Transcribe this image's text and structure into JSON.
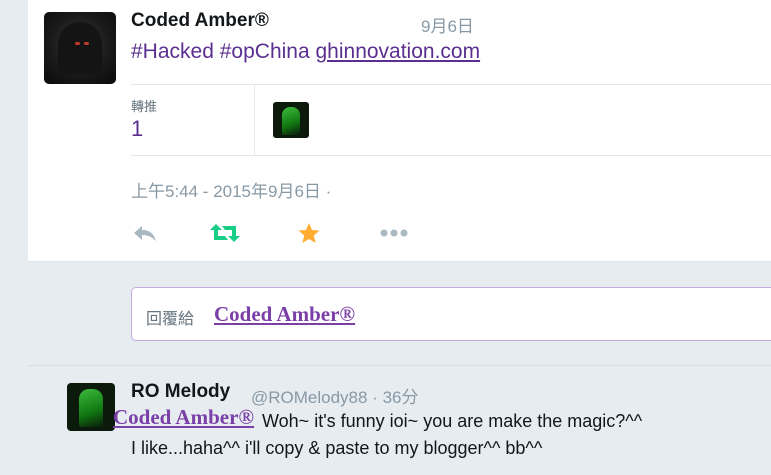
{
  "colors": {
    "link": "#5b2f8f",
    "mention": "#7b3fa8",
    "muted": "#8899a6",
    "retweet_green": "#19cf86",
    "favorite_gold": "#ffac33",
    "icon_gray": "#aab8c2"
  },
  "tweet": {
    "author_name": "Coded Amber®",
    "date_short": "9月6日",
    "hashtag1": "#Hacked",
    "hashtag2": "#opChina",
    "link": "ghinnovation.com",
    "retweet_label": "轉推",
    "retweet_count": "1",
    "timestamp": "上午5:44 - 2015年9月6日 ·"
  },
  "actions": {
    "reply_icon": "reply-icon",
    "retweet_icon": "retweet-icon",
    "favorite_icon": "star-icon",
    "more_icon": "more-icon"
  },
  "reply_box": {
    "prefix": "回覆給",
    "target_name": "Coded Amber®"
  },
  "reply": {
    "author_name": "RO Melody",
    "handle_time": "@ROMelody88 · 36分",
    "mention_overlay": "Coded Amber®",
    "line1": "Woh~ it's funny ioi~ you are make the magic?^^",
    "line2": "I like...haha^^ i'll copy & paste to my blogger^^ bb^^"
  }
}
